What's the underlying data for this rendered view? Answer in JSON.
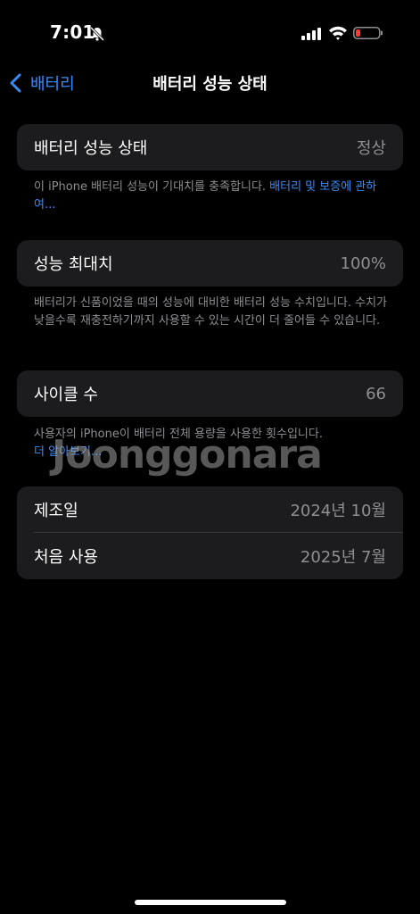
{
  "status_bar": {
    "time": "7:01",
    "icons": [
      "bell-slash-icon",
      "signal-icon",
      "wifi-icon",
      "battery-low-icon"
    ]
  },
  "nav": {
    "back_label": "배터리",
    "title": "배터리 성능 상태"
  },
  "health": {
    "label": "배터리 성능 상태",
    "value": "정상",
    "note_text": "이 iPhone 배터리 성능이 기대치를 충족합니다. ",
    "note_link": "배터리 및 보증에 관하여..."
  },
  "max_capacity": {
    "label": "성능 최대치",
    "value": "100%",
    "note_text": "배터리가 신품이었을 때의 성능에 대비한 배터리 성능 수치입니다. 수치가 낮을수록 재충전하기까지 사용할 수 있는 시간이 더 줄어들 수 있습니다."
  },
  "cycle_count": {
    "label": "사이클 수",
    "value": "66",
    "note_text": "사용자의 iPhone이 배터리 전체 용량을 사용한 횟수입니다.",
    "note_link": "더 알아보기..."
  },
  "dates": {
    "manufacture_label": "제조일",
    "manufacture_value": "2024년 10월",
    "first_use_label": "처음 사용",
    "first_use_value": "2025년 7월"
  },
  "watermark": "Joonggonara",
  "colors": {
    "accent": "#3a8cf5",
    "card_bg": "#1c1c1e",
    "secondary_text": "#8e8e93",
    "battery_low": "#ff3b30"
  }
}
